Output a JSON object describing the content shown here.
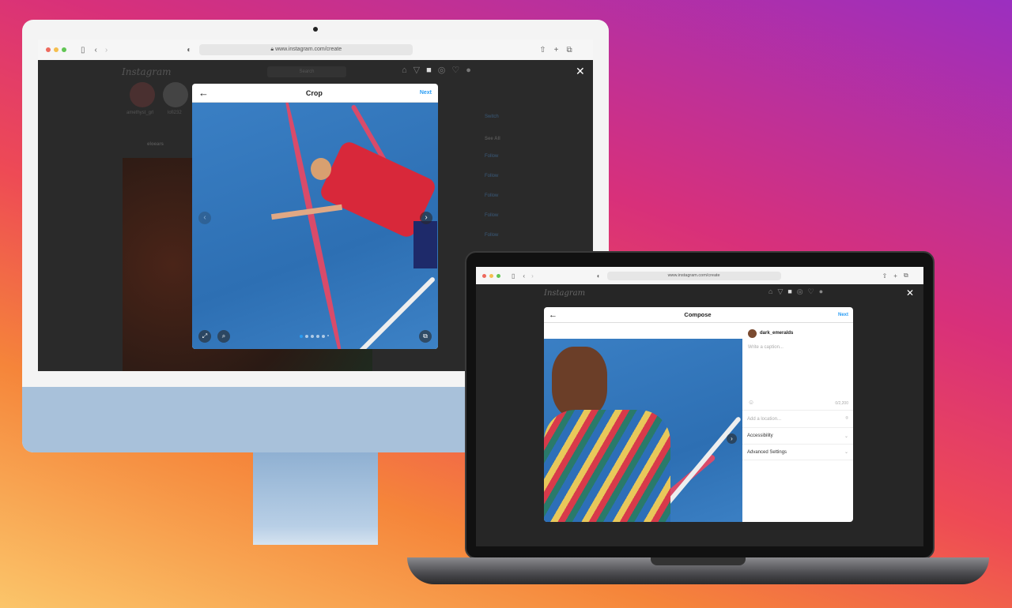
{
  "desktop": {
    "url": "www.instagram.com/create",
    "logo": "Instagram",
    "search_placeholder": "Search",
    "close": "✕",
    "stories": [
      "amethyst_grl",
      "lofi232"
    ],
    "post_user": "eloears",
    "sidebar": {
      "switch": "Switch",
      "see_all": "See All",
      "follow": "Follow"
    },
    "modal": {
      "title": "Crop",
      "next": "Next",
      "back": "←",
      "photo_index": 1,
      "photo_count": 6
    }
  },
  "laptop": {
    "url": "www.instagram.com/create",
    "logo": "Instagram",
    "close": "✕",
    "modal": {
      "title": "Compose",
      "next": "Next",
      "back": "←",
      "username": "dark_emeralds",
      "caption_placeholder": "Write a caption...",
      "char_count": "0/2,200",
      "location_placeholder": "Add a location...",
      "accessibility": "Accessibility",
      "advanced": "Advanced Settings",
      "photo_index": 1,
      "photo_count": 6
    }
  },
  "colors": {
    "accent": "#2a9df4",
    "imac_chin": "#a8c1da"
  }
}
